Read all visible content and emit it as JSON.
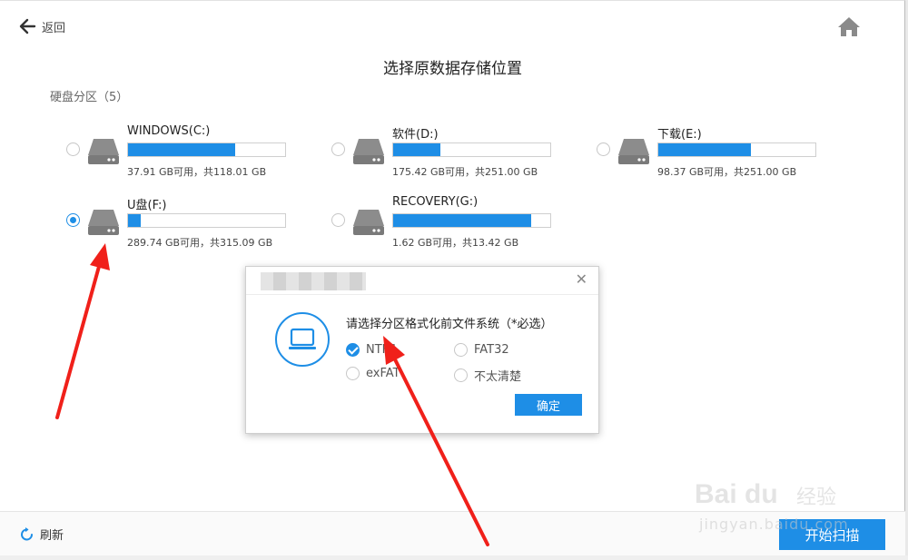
{
  "header": {
    "back_label": "返回",
    "title": "选择原数据存储位置"
  },
  "section": {
    "label": "硬盘分区（5）"
  },
  "partitions": [
    {
      "name": "WINDOWS(C:)",
      "info": "37.91 GB可用，共118.01 GB",
      "used_fraction": 0.68,
      "selected": false
    },
    {
      "name": "软件(D:)",
      "info": "175.42 GB可用，共251.00 GB",
      "used_fraction": 0.3,
      "selected": false
    },
    {
      "name": "下载(E:)",
      "info": "98.37 GB可用，共251.00 GB",
      "used_fraction": 0.59,
      "selected": false
    },
    {
      "name": "U盘(F:)",
      "info": "289.74 GB可用，共315.09 GB",
      "used_fraction": 0.08,
      "selected": true
    },
    {
      "name": "RECOVERY(G:)",
      "info": "1.62 GB可用，共13.42 GB",
      "used_fraction": 0.88,
      "selected": false
    }
  ],
  "dialog": {
    "question": "请选择分区格式化前文件系统（*必选）",
    "options": [
      {
        "label": "NTFS",
        "checked": true
      },
      {
        "label": "FAT32",
        "checked": false
      },
      {
        "label": "exFAT",
        "checked": false
      },
      {
        "label": "不太清楚",
        "checked": false
      }
    ],
    "ok_label": "确定",
    "close_glyph": "✕"
  },
  "footer": {
    "refresh_label": "刷新",
    "scan_label": "开始扫描"
  },
  "watermark": {
    "logo": "Bai du",
    "cn": "经验",
    "url": "jingyan.baidu.com"
  },
  "colors": {
    "accent": "#1e8ee6",
    "annotation_arrow": "#f0201a"
  },
  "icons": [
    "back-arrow-icon",
    "home-icon",
    "disk-icon",
    "laptop-icon",
    "refresh-icon",
    "close-icon"
  ]
}
